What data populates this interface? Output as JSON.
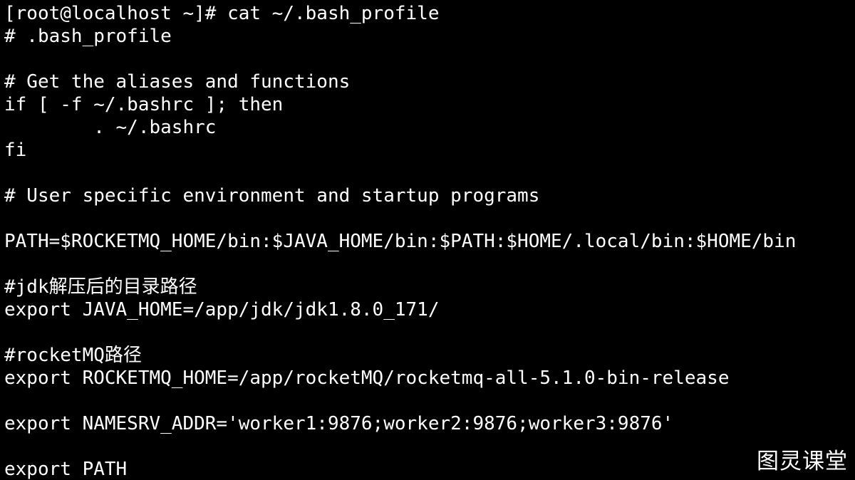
{
  "terminal": {
    "lines": [
      "[root@localhost ~]# cat ~/.bash_profile",
      "# .bash_profile",
      "",
      "# Get the aliases and functions",
      "if [ -f ~/.bashrc ]; then",
      "        . ~/.bashrc",
      "fi",
      "",
      "# User specific environment and startup programs",
      "",
      "PATH=$ROCKETMQ_HOME/bin:$JAVA_HOME/bin:$PATH:$HOME/.local/bin:$HOME/bin",
      "",
      "#jdk解压后的目录路径",
      "export JAVA_HOME=/app/jdk/jdk1.8.0_171/",
      "",
      "#rocketMQ路径",
      "export ROCKETMQ_HOME=/app/rocketMQ/rocketmq-all-5.1.0-bin-release",
      "",
      "export NAMESRV_ADDR='worker1:9876;worker2:9876;worker3:9876'",
      "",
      "export PATH"
    ]
  },
  "watermark": "图灵课堂",
  "colors": {
    "background": "#000000",
    "foreground": "#ffffff"
  }
}
